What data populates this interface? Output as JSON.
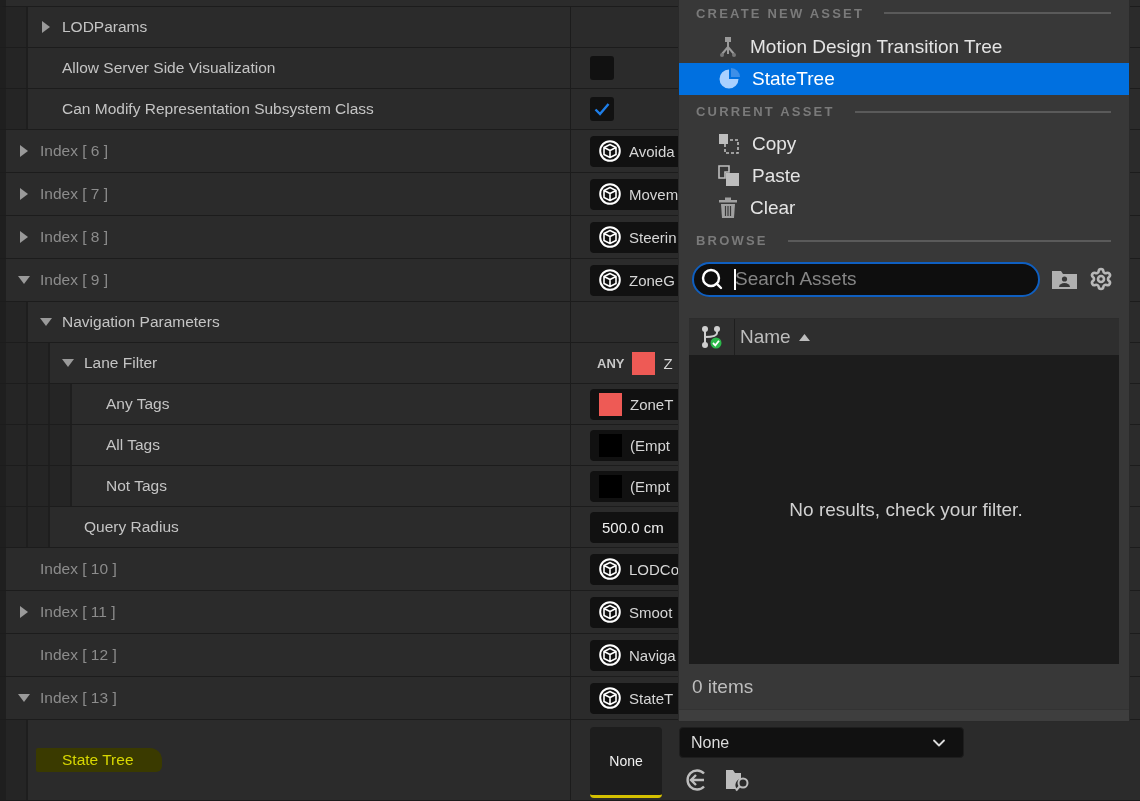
{
  "partial_group": {
    "children": [
      {
        "label": "LODParams",
        "expanded": false
      },
      {
        "label": "Allow Server Side Visualization",
        "value": {
          "kind": "checkbox",
          "checked": false
        }
      },
      {
        "label": "Can Modify Representation Subsystem Class",
        "value": {
          "kind": "checkbox",
          "checked": true
        }
      }
    ]
  },
  "properties": [
    {
      "label": "Index [ 6 ]",
      "expanded": false,
      "value": {
        "kind": "asset",
        "text": "Avoida"
      }
    },
    {
      "label": "Index [ 7 ]",
      "expanded": false,
      "value": {
        "kind": "asset",
        "text": "Movem"
      }
    },
    {
      "label": "Index [ 8 ]",
      "expanded": false,
      "value": {
        "kind": "asset",
        "text": "Steerin"
      }
    },
    {
      "label": "Index [ 9 ]",
      "expanded": true,
      "value": {
        "kind": "asset",
        "text": "ZoneG"
      },
      "children": [
        {
          "label": "Navigation Parameters",
          "expanded": true,
          "children": [
            {
              "label": "Lane Filter",
              "expanded": true,
              "value": {
                "kind": "tag_query",
                "prefix": "ANY",
                "color": "#ee5a55",
                "text": "Z"
              },
              "children": [
                {
                  "label": "Any Tags",
                  "value": {
                    "kind": "tag",
                    "color": "#ee5a55",
                    "text": "ZoneT"
                  }
                },
                {
                  "label": "All Tags",
                  "value": {
                    "kind": "tag",
                    "color": "#000000",
                    "text": "(Empt"
                  }
                },
                {
                  "label": "Not Tags",
                  "value": {
                    "kind": "tag",
                    "color": "#000000",
                    "text": "(Empt"
                  }
                }
              ]
            },
            {
              "label": "Query Radius",
              "value": {
                "kind": "number",
                "text": "500.0 cm"
              }
            }
          ]
        }
      ]
    },
    {
      "label": "Index [ 10 ]",
      "value": {
        "kind": "asset",
        "text": "LODCo"
      }
    },
    {
      "label": "Index [ 11 ]",
      "expanded": false,
      "value": {
        "kind": "asset",
        "text": "Smoot"
      }
    },
    {
      "label": "Index [ 12 ]",
      "value": {
        "kind": "asset",
        "text": "Naviga"
      }
    },
    {
      "label": "Index [ 13 ]",
      "expanded": true,
      "value": {
        "kind": "asset",
        "text": "StateT"
      },
      "children": [
        {
          "label": "State Tree",
          "highlighted": true,
          "value": {
            "kind": "asset_picker",
            "thumbnail": "None",
            "selection": "None"
          }
        }
      ]
    }
  ],
  "asset_menu": {
    "sections": [
      {
        "title": "CREATE NEW ASSET",
        "items": [
          {
            "label": "Motion Design Transition Tree",
            "selected": false
          },
          {
            "label": "StateTree",
            "selected": true
          }
        ]
      },
      {
        "title": "CURRENT ASSET",
        "items": [
          {
            "label": "Copy",
            "selected": false
          },
          {
            "label": "Paste",
            "selected": false
          },
          {
            "label": "Clear",
            "selected": false
          }
        ]
      },
      {
        "title": "BROWSE"
      }
    ],
    "search": {
      "placeholder": "Search Assets",
      "focused": true
    },
    "list": {
      "column": "Name",
      "sort_ascending": true,
      "empty_message": "No results, check your filter."
    },
    "item_count": "0 items"
  }
}
